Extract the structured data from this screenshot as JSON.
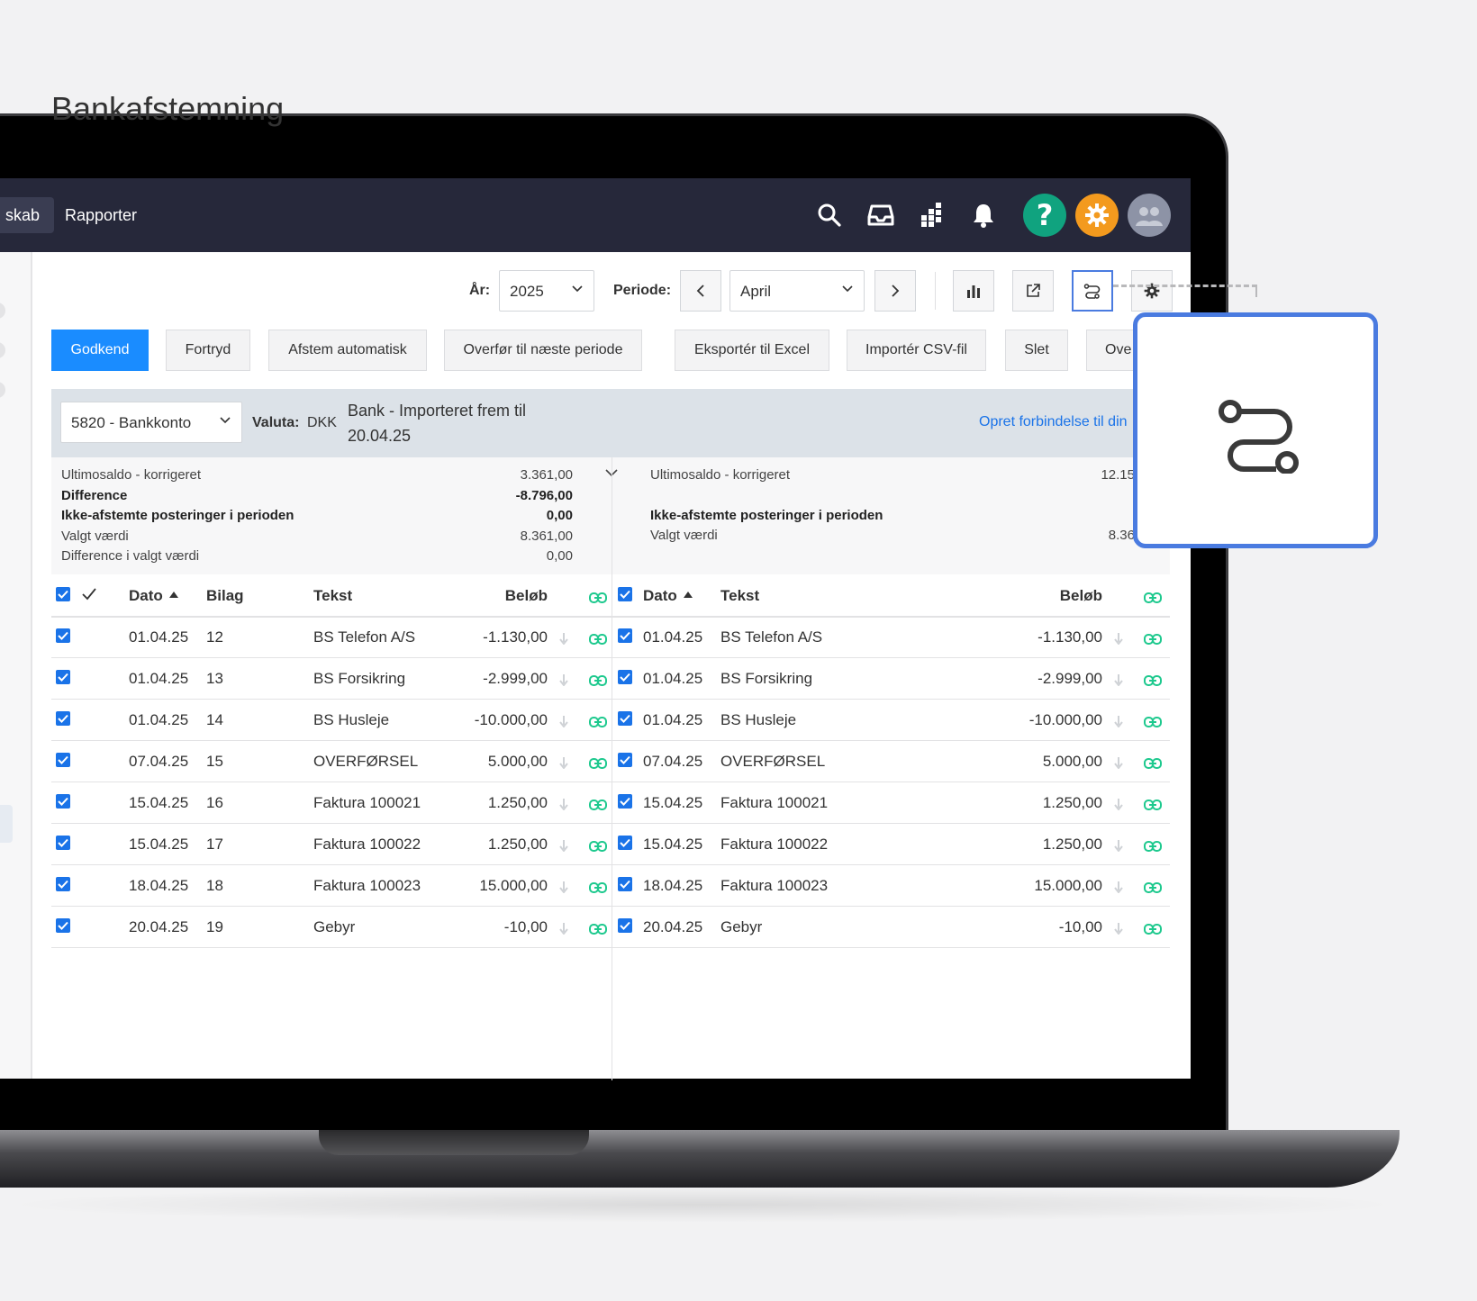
{
  "nav": {
    "prev_tab": "skab",
    "tab": "Rapporter",
    "icons": [
      "search-icon",
      "inbox-icon",
      "apps-grid-icon",
      "bell-icon",
      "help-icon",
      "settings-icon",
      "avatar"
    ]
  },
  "page": {
    "title": "Bankafstemning"
  },
  "filters": {
    "year_label": "År:",
    "year_value": "2025",
    "period_label": "Periode:",
    "period_value": "April"
  },
  "toolbar": {
    "approve": "Godkend",
    "undo": "Fortryd",
    "auto_reconcile": "Afstem automatisk",
    "transfer_next": "Overfør til næste periode",
    "export_excel": "Eksportér til Excel",
    "import_csv": "Importér CSV-fil",
    "delete": "Slet",
    "more": "Ove"
  },
  "account_band": {
    "account_value": "5820 - Bankkonto",
    "currency_label": "Valuta:",
    "currency_value": "DKK",
    "bank_line1": "Bank - Importeret frem til",
    "bank_line2": "20.04.25",
    "connect_link": "Opret forbindelse til din"
  },
  "summary_left": {
    "rows": [
      {
        "label": "Ultimosaldo - korrigeret",
        "value": "3.361,00",
        "bold": false
      },
      {
        "label": "Difference",
        "value": "-8.796,00",
        "bold": true
      },
      {
        "label": "Ikke-afstemte posteringer i perioden",
        "value": "0,00",
        "bold": true
      },
      {
        "label": "Valgt værdi",
        "value": "8.361,00",
        "bold": false
      },
      {
        "label": "Difference i valgt værdi",
        "value": "0,00",
        "bold": false
      }
    ]
  },
  "summary_right": {
    "row1_label": "Ultimosaldo - korrigeret",
    "row1_value": "12.15",
    "row3_label": "Ikke-afstemte posteringer i perioden",
    "row4_label": "Valgt værdi",
    "row4_value": "8.36"
  },
  "left_table": {
    "headers": {
      "date": "Dato",
      "voucher": "Bilag",
      "text": "Tekst",
      "amount": "Beløb"
    },
    "rows": [
      {
        "date": "01.04.25",
        "voucher": "12",
        "text": "BS Telefon A/S",
        "amount": "-1.130,00"
      },
      {
        "date": "01.04.25",
        "voucher": "13",
        "text": "BS Forsikring",
        "amount": "-2.999,00"
      },
      {
        "date": "01.04.25",
        "voucher": "14",
        "text": "BS Husleje",
        "amount": "-10.000,00"
      },
      {
        "date": "07.04.25",
        "voucher": "15",
        "text": "OVERFØRSEL",
        "amount": "5.000,00"
      },
      {
        "date": "15.04.25",
        "voucher": "16",
        "text": "Faktura 100021",
        "amount": "1.250,00"
      },
      {
        "date": "15.04.25",
        "voucher": "17",
        "text": "Faktura 100022",
        "amount": "1.250,00"
      },
      {
        "date": "18.04.25",
        "voucher": "18",
        "text": "Faktura 100023",
        "amount": "15.000,00"
      },
      {
        "date": "20.04.25",
        "voucher": "19",
        "text": "Gebyr",
        "amount": "-10,00"
      }
    ]
  },
  "right_table": {
    "headers": {
      "date": "Dato",
      "text": "Tekst",
      "amount": "Beløb"
    },
    "rows": [
      {
        "date": "01.04.25",
        "text": "BS Telefon A/S",
        "amount": "-1.130,00"
      },
      {
        "date": "01.04.25",
        "text": "BS Forsikring",
        "amount": "-2.999,00"
      },
      {
        "date": "01.04.25",
        "text": "BS Husleje",
        "amount": "-10.000,00"
      },
      {
        "date": "07.04.25",
        "text": "OVERFØRSEL",
        "amount": "5.000,00"
      },
      {
        "date": "15.04.25",
        "text": "Faktura 100021",
        "amount": "1.250,00"
      },
      {
        "date": "15.04.25",
        "text": "Faktura 100022",
        "amount": "1.250,00"
      },
      {
        "date": "18.04.25",
        "text": "Faktura 100023",
        "amount": "15.000,00"
      },
      {
        "date": "20.04.25",
        "text": "Gebyr",
        "amount": "-10,00"
      }
    ]
  },
  "colors": {
    "nav_bg": "#26283a",
    "primary": "#1a8cff",
    "help": "#10a37f",
    "settings": "#f39a1e",
    "link_icon": "#1ec98e",
    "callout_border": "#4a7be0"
  }
}
